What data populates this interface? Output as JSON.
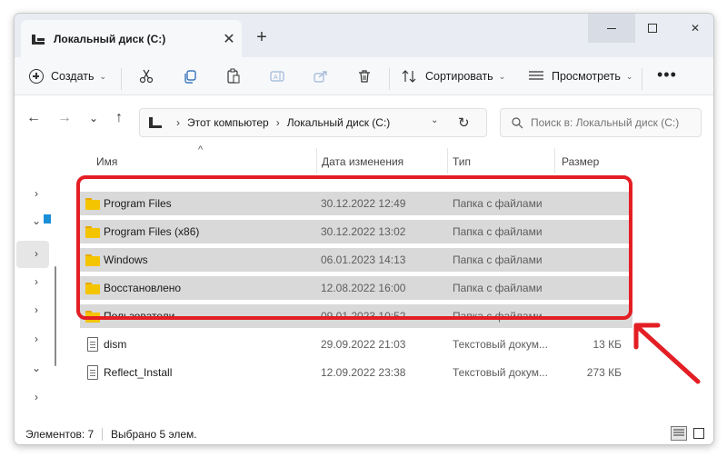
{
  "window": {
    "tab_title": "Локальный диск (C:)",
    "close_tab_glyph": "✕",
    "new_tab_glyph": "+",
    "close_window_glyph": "✕"
  },
  "commandbar": {
    "create_label": "Создать",
    "sort_label": "Сортировать",
    "view_label": "Просмотреть",
    "more_glyph": "•••",
    "chevron_glyph": "⌄",
    "icons": [
      "cut-icon",
      "copy-icon",
      "paste-icon",
      "rename-icon",
      "share-icon",
      "delete-icon"
    ]
  },
  "navigation": {
    "back_glyph": "←",
    "forward_glyph": "→",
    "recent_glyph": "⌄",
    "up_glyph": "↑",
    "breadcrumb": [
      "Этот компьютер",
      "Локальный диск (C:)"
    ],
    "breadcrumb_separator": "›",
    "dropdown_glyph": "⌄",
    "refresh_glyph": "↻",
    "search_placeholder": "Поиск в: Локальный диск (C:)"
  },
  "navpane": {
    "expand_glyph": "›",
    "collapse_glyph": "⌄"
  },
  "columns": {
    "name": "Имя",
    "date": "Дата изменения",
    "type": "Тип",
    "size": "Размер",
    "sort_glyph": "^"
  },
  "files": [
    {
      "name": "Program Files",
      "date": "30.12.2022 12:49",
      "type": "Папка с файлами",
      "size": "",
      "kind": "folder",
      "selected": true
    },
    {
      "name": "Program Files (x86)",
      "date": "30.12.2022 13:02",
      "type": "Папка с файлами",
      "size": "",
      "kind": "folder",
      "selected": true
    },
    {
      "name": "Windows",
      "date": "06.01.2023 14:13",
      "type": "Папка с файлами",
      "size": "",
      "kind": "folder",
      "selected": true
    },
    {
      "name": "Восстановлено",
      "date": "12.08.2022 16:00",
      "type": "Папка с файлами",
      "size": "",
      "kind": "folder",
      "selected": true
    },
    {
      "name": "Пользователи",
      "date": "09.01.2023 10:52",
      "type": "Папка с файлами",
      "size": "",
      "kind": "folder",
      "selected": true
    },
    {
      "name": "dism",
      "date": "29.09.2022 21:03",
      "type": "Текстовый докум...",
      "size": "13 КБ",
      "kind": "file",
      "selected": false
    },
    {
      "name": "Reflect_Install",
      "date": "12.09.2022 23:38",
      "type": "Текстовый докум...",
      "size": "273 КБ",
      "kind": "file",
      "selected": false
    }
  ],
  "status": {
    "items_count": "Элементов: 7",
    "selected_count": "Выбрано 5 элем."
  },
  "colors": {
    "annotation_red": "#e31e24",
    "selection_grey": "#d9d9d9",
    "folder_yellow": "#f5c400"
  }
}
